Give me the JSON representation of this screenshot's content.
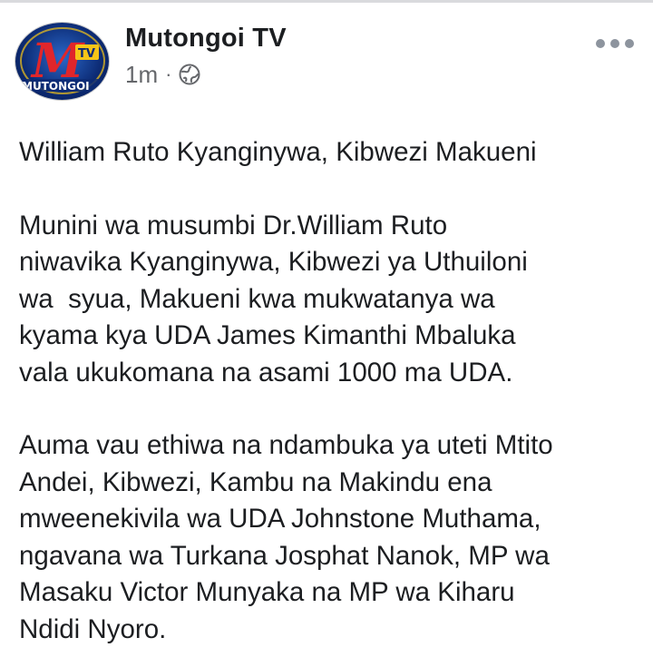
{
  "post": {
    "page_name": "Mutongoi TV",
    "timestamp": "1m",
    "separator": "·",
    "privacy_icon": "globe-icon",
    "more_icon": "more-options-icon",
    "avatar": {
      "logo_letter": "M",
      "logo_badge": "TV",
      "logo_text": "MUTONGOI"
    },
    "paragraphs": [
      "William Ruto Kyanginywa, Kibwezi Makueni",
      "Munini wa musumbi Dr.William Ruto\nniwavika Kyanginywa, Kibwezi ya Uthuiloni\nwa  syua, Makueni kwa mukwatanya wa\nkyama kya UDA James Kimanthi Mbaluka\nvala ukukomana na asami 1000 ma UDA.",
      "Auma vau ethiwa na ndambuka ya uteti Mtito\nAndei, Kibwezi, Kambu na Makindu ena\nmweenekivila wa UDA Johnstone Muthama,\nngavana wa Turkana Josphat Nanok, MP wa\nMasaku Victor Munyaka na MP wa Kiharu\nNdidi Nyoro."
    ]
  },
  "colors": {
    "text": "#1c1e21",
    "secondary_text": "#65676b",
    "icon_gray": "#8d949e",
    "logo_blue": "#0c2a73",
    "logo_red": "#e0262b",
    "logo_yellow": "#f5c518"
  }
}
